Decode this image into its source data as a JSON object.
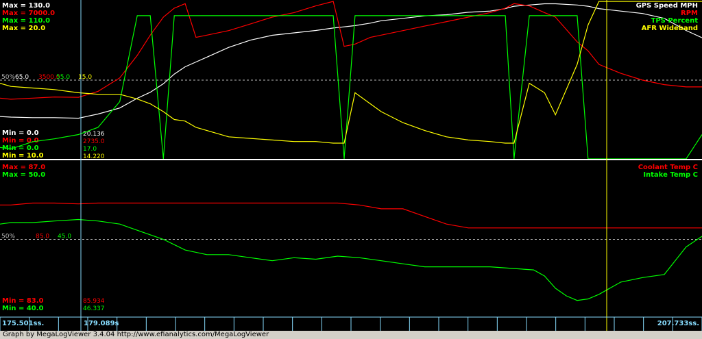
{
  "footer": "Graph by MegaLogViewer 3.4.04 http://www.efianalytics.com/MegaLogViewer",
  "time_axis": {
    "start": "175.501ss.",
    "cursor": "179.089s",
    "end": "207.733ss."
  },
  "colors": {
    "speed": "#ffffff",
    "rpm": "#ff0000",
    "tps": "#00ff00",
    "afr": "#ffff00",
    "coolant": "#ff0000",
    "intake": "#00ff00",
    "cursor": "#88ddff",
    "marker": "#ffff00"
  },
  "chart_data": [
    {
      "type": "line",
      "x": [
        175.5,
        176,
        177,
        178,
        179.1,
        180,
        181,
        181.8,
        182.4,
        183,
        183.5,
        184,
        184.5,
        185,
        186,
        187,
        188,
        189,
        190,
        190.8,
        191.3,
        191.8,
        192.5,
        193,
        194,
        195,
        196,
        197,
        198,
        198.7,
        199.1,
        199.8,
        200.5,
        201,
        202,
        202.5,
        203,
        204,
        205,
        206,
        207,
        207.73
      ],
      "series": [
        {
          "name": "GPS Speed MPH",
          "min": 0,
          "max": 130,
          "cursor_value": "20.136",
          "values": [
            35,
            34.5,
            34,
            34,
            33.6,
            37,
            42,
            50,
            55,
            62,
            70,
            76,
            80,
            84,
            92,
            98,
            102,
            104,
            106,
            108,
            109,
            110,
            112,
            114,
            116,
            118,
            119,
            121,
            122,
            124,
            126,
            127,
            128,
            128,
            127,
            126,
            124,
            122,
            120,
            116,
            106,
            100
          ]
        },
        {
          "name": "RPM",
          "min": 0,
          "max": 7000,
          "cursor_value": "2735.0",
          "values": [
            2700,
            2650,
            2700,
            2750,
            2735,
            3000,
            3600,
            4600,
            5500,
            6300,
            6700,
            6900,
            5400,
            5500,
            5700,
            6000,
            6300,
            6500,
            6800,
            7000,
            5000,
            5100,
            5400,
            5500,
            5700,
            5900,
            6100,
            6300,
            6500,
            6700,
            6900,
            6800,
            6500,
            6300,
            5200,
            4800,
            4200,
            3800,
            3500,
            3300,
            3200,
            3200
          ]
        },
        {
          "name": "TPS Percent",
          "min": 0,
          "max": 110,
          "cursor_value": "17.0",
          "values": [
            8,
            7,
            12,
            14,
            17,
            22,
            40,
            100,
            100,
            0,
            100,
            100,
            100,
            100,
            100,
            100,
            100,
            100,
            100,
            100,
            0,
            100,
            100,
            100,
            100,
            100,
            100,
            100,
            100,
            100,
            0,
            100,
            100,
            100,
            100,
            0,
            0,
            0,
            0,
            0,
            0,
            17
          ]
        },
        {
          "name": "AFR Wideband",
          "min": 10,
          "max": 20,
          "cursor_value": "14.220",
          "values": [
            14.8,
            14.6,
            14.5,
            14.4,
            14.2,
            14.1,
            14.1,
            13.8,
            13.5,
            13.0,
            12.5,
            12.4,
            12.0,
            11.8,
            11.4,
            11.3,
            11.2,
            11.1,
            11.1,
            11.0,
            11.0,
            14.2,
            13.5,
            13.0,
            12.3,
            11.8,
            11.4,
            11.2,
            11.1,
            11.0,
            11.0,
            14.8,
            14.2,
            12.8,
            16.0,
            18.5,
            20.0,
            20.0,
            20.0,
            20.0,
            20.0,
            20.0
          ]
        }
      ]
    },
    {
      "type": "line",
      "x": [
        175.5,
        176,
        177,
        178,
        179.1,
        180,
        181,
        182,
        183,
        184,
        185,
        186,
        187,
        188,
        189,
        190,
        191,
        192,
        193,
        194,
        195,
        196,
        197,
        198,
        199,
        200,
        200.5,
        201,
        201.5,
        202,
        202.5,
        203,
        204,
        205,
        206,
        207,
        207.73
      ],
      "series": [
        {
          "name": "Coolant Temp C",
          "min": 83,
          "max": 87,
          "cursor_value": "85.934",
          "values": [
            85.9,
            85.9,
            85.95,
            85.95,
            85.93,
            85.95,
            85.95,
            85.95,
            85.95,
            85.95,
            85.95,
            85.95,
            85.95,
            85.95,
            85.95,
            85.95,
            85.95,
            85.9,
            85.8,
            85.8,
            85.6,
            85.4,
            85.3,
            85.3,
            85.3,
            85.3,
            85.3,
            85.3,
            85.3,
            85.3,
            85.3,
            85.3,
            85.3,
            85.3,
            85.3,
            85.3,
            85.3
          ]
        },
        {
          "name": "Intake Temp C",
          "min": 40,
          "max": 50,
          "cursor_value": "46.337",
          "values": [
            46.0,
            46.1,
            46.1,
            46.2,
            46.3,
            46.2,
            46.0,
            45.5,
            45.0,
            44.3,
            44.0,
            44.0,
            43.8,
            43.6,
            43.8,
            43.7,
            43.9,
            43.8,
            43.6,
            43.4,
            43.2,
            43.2,
            43.2,
            43.2,
            43.1,
            43.0,
            42.6,
            41.8,
            41.3,
            41.0,
            41.1,
            41.4,
            42.2,
            42.5,
            42.7,
            44.5,
            45.2
          ]
        }
      ]
    }
  ]
}
